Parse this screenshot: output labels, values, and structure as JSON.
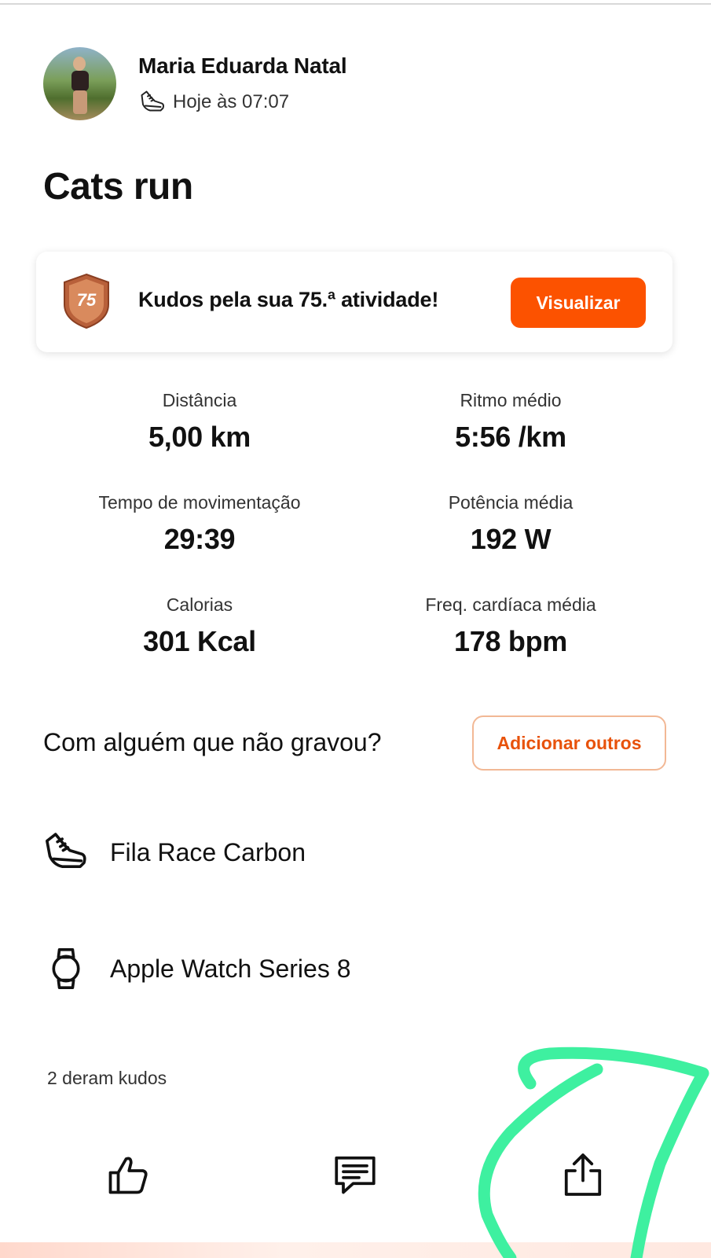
{
  "user": {
    "name": "Maria Eduarda Natal",
    "timestamp": "Hoje às 07:07",
    "activity_icon": "shoe-icon"
  },
  "activity": {
    "title": "Cats run"
  },
  "kudos_card": {
    "badge_number": "75",
    "message": "Kudos pela sua 75.ª atividade!",
    "button_label": "Visualizar",
    "accent_color": "#fc5200"
  },
  "stats": [
    {
      "label": "Distância",
      "value": "5,00 km"
    },
    {
      "label": "Ritmo médio",
      "value": "5:56 /km"
    },
    {
      "label": "Tempo de movimentação",
      "value": "29:39"
    },
    {
      "label": "Potência média",
      "value": "192 W"
    },
    {
      "label": "Calorias",
      "value": "301 Kcal"
    },
    {
      "label": "Freq. cardíaca média",
      "value": "178 bpm"
    }
  ],
  "others": {
    "question": "Com alguém que não gravou?",
    "button_label": "Adicionar outros"
  },
  "gear": [
    {
      "icon": "shoe-icon",
      "label": "Fila Race Carbon"
    },
    {
      "icon": "watch-icon",
      "label": "Apple Watch Series 8"
    }
  ],
  "kudos_count": "2 deram kudos",
  "actions": [
    {
      "icon": "thumbs-up-icon"
    },
    {
      "icon": "comment-icon"
    },
    {
      "icon": "share-icon"
    }
  ],
  "annotation_color": "#3ef0a0"
}
